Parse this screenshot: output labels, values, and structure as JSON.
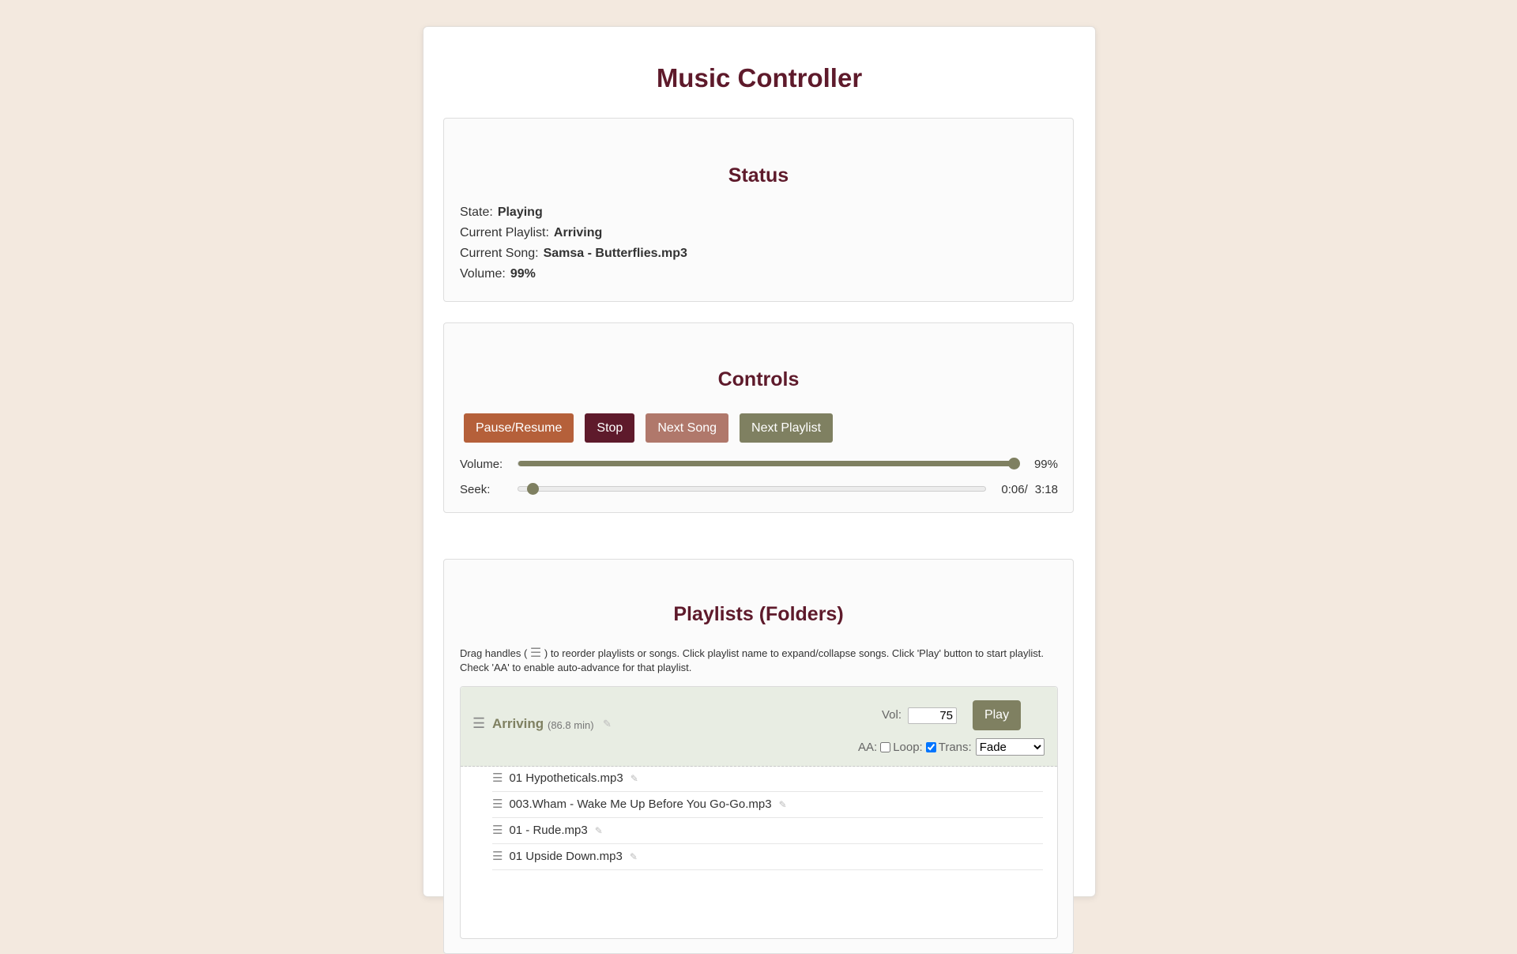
{
  "title": "Music Controller",
  "status": {
    "heading": "Status",
    "state_label": "State:",
    "state": "Playing",
    "playlist_label": "Current Playlist:",
    "playlist": "Arriving",
    "song_label": "Current Song:",
    "song": "Samsa - Butterflies.mp3",
    "volume_label": "Volume:",
    "volume": "99%"
  },
  "controls": {
    "heading": "Controls",
    "pause_label": "Pause/Resume",
    "stop_label": "Stop",
    "next_song_label": "Next Song",
    "next_playlist_label": "Next Playlist",
    "volume_label": "Volume:",
    "volume_value": "99%",
    "volume_fraction": 0.99,
    "seek_label": "Seek:",
    "seek_current": "0:06/",
    "seek_total": "3:18",
    "seek_fraction": 0.03,
    "accent_color": "#7f8061"
  },
  "playlists": {
    "heading": "Playlists (Folders)",
    "instructions_before": "Drag handles (",
    "instructions_after": ") to reorder playlists or songs. Click playlist name to expand/collapse songs. Click 'Play' button to start playlist. Check 'AA' to enable auto-advance for that playlist.",
    "handle_icon": "drag-handle-icon",
    "handle_glyph": "☰",
    "edit_glyph": "✎",
    "items": [
      {
        "name": "Arriving",
        "duration": "(86.8 min)",
        "vol_label": "Vol:",
        "vol": "75",
        "play_label": "Play",
        "aa_label": "AA:",
        "aa_checked": false,
        "loop_label": "Loop:",
        "loop_checked": true,
        "trans_label": "Trans:",
        "trans": "Fade",
        "songs": [
          "01 Hypotheticals.mp3",
          "003.Wham - Wake Me Up Before You Go-Go.mp3",
          "01 - Rude.mp3",
          "01 Upside Down.mp3"
        ]
      }
    ]
  }
}
